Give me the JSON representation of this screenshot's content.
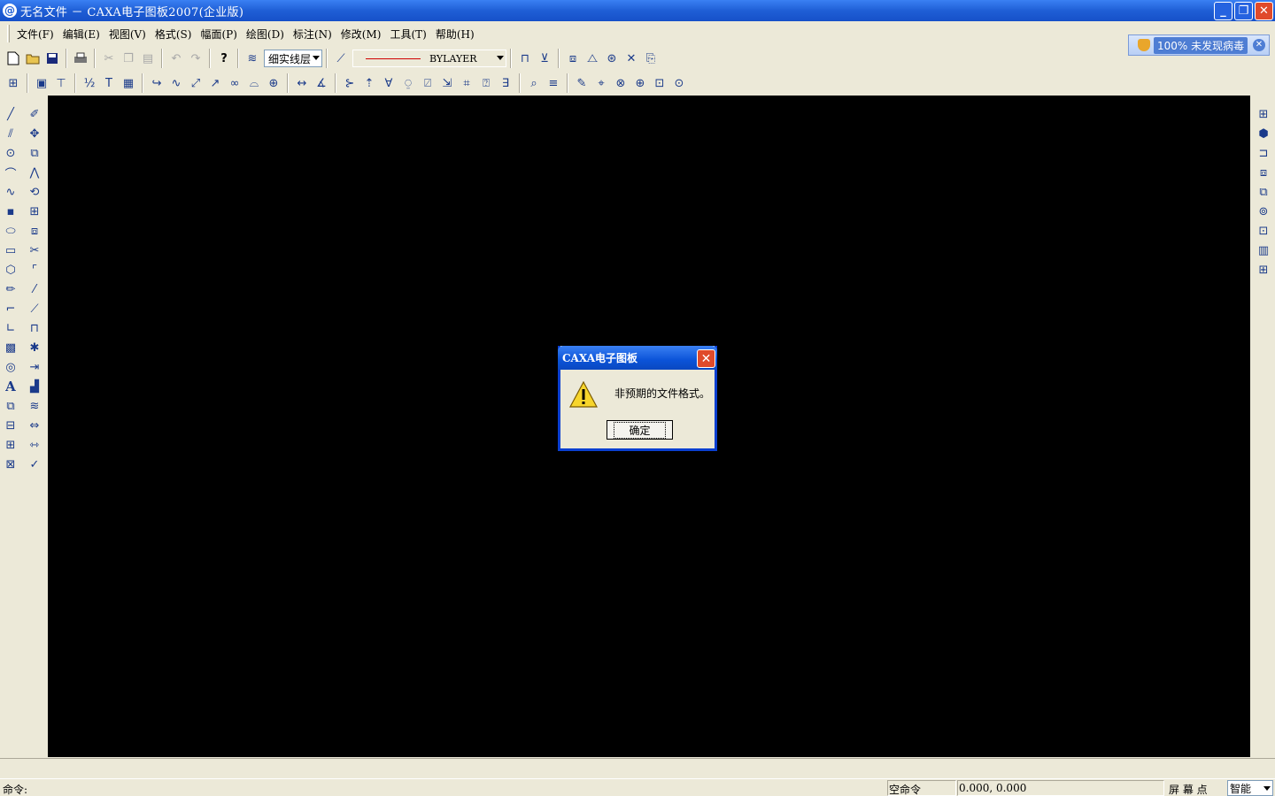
{
  "window": {
    "title": "无名文件 － CAXA电子图板2007(企业版)",
    "controls": {
      "minimize": "_",
      "restore": "❐",
      "close": "✕"
    }
  },
  "menu": {
    "items": [
      {
        "label": "文件(F)"
      },
      {
        "label": "编辑(E)"
      },
      {
        "label": "视图(V)"
      },
      {
        "label": "格式(S)"
      },
      {
        "label": "幅面(P)"
      },
      {
        "label": "绘图(D)"
      },
      {
        "label": "标注(N)"
      },
      {
        "label": "修改(M)"
      },
      {
        "label": "工具(T)"
      },
      {
        "label": "帮助(H)"
      }
    ]
  },
  "antivirus": {
    "text": "100%  未发现病毒",
    "close": "✕"
  },
  "toolbar": {
    "layer_value": "细实线层",
    "linetype_value": "BYLAYER",
    "line_color": "#d00000"
  },
  "dialog": {
    "title": "CAXA电子图板",
    "message": "非预期的文件格式。",
    "ok_label": "确定",
    "close": "✕"
  },
  "status": {
    "command_prompt": "命令:",
    "command_state": "空命令",
    "coordinates": "0.000, 0.000",
    "snap_label": "屏 幕 点",
    "snap_mode": "智能"
  },
  "colors": {
    "canvas": "#000000",
    "titlebar": "#1f5fd6",
    "chrome": "#ece9d8"
  }
}
